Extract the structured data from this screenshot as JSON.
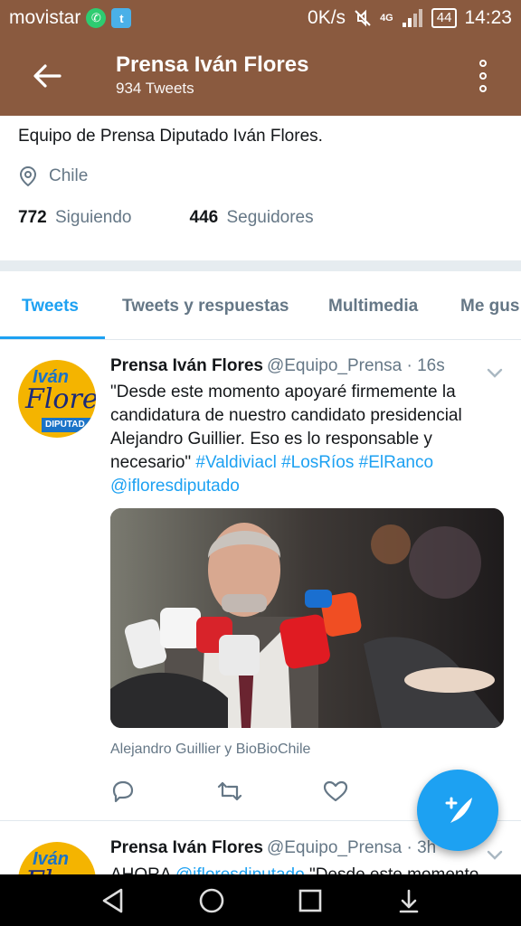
{
  "status": {
    "carrier": "movistar",
    "speed": "0K/s",
    "network": "4G",
    "battery": "44",
    "time": "14:23"
  },
  "appbar": {
    "title": "Prensa Iván Flores",
    "subtitle": "934 Tweets"
  },
  "profile": {
    "bio": "Equipo de Prensa Diputado Iván Flores.",
    "location": "Chile",
    "following_count": "772",
    "following_label": "Siguiendo",
    "followers_count": "446",
    "followers_label": "Seguidores"
  },
  "tabs": [
    {
      "label": "Tweets"
    },
    {
      "label": "Tweets y respuestas"
    },
    {
      "label": "Multimedia"
    },
    {
      "label": "Me gus"
    }
  ],
  "tweets": [
    {
      "name": "Prensa Iván Flores",
      "handle": "@Equipo_Prensa · 16s",
      "text_part1": "\"Desde este momento apoyaré firmemente la candidatura de nuestro candidato presidencial Alejandro Guillier. Eso es lo responsable y necesario\" ",
      "hashtags": "#Valdiviacl #LosRíos #ElRanco",
      "mention": "@ifloresdiputado",
      "caption": "Alejandro Guillier y BioBioChile"
    },
    {
      "name": "Prensa Iván Flores",
      "handle": "@Equipo_Prensa · 3h",
      "text_prefix": "AHORA ",
      "mention": "@ifloresdiputado",
      "text_suffix": " \"Desde este momento"
    }
  ],
  "avatar": {
    "line1": "Iván",
    "line2": "Flores",
    "line3": "DIPUTAD"
  },
  "colors": {
    "header": "#8a5a3f",
    "accent": "#1da1f2"
  }
}
